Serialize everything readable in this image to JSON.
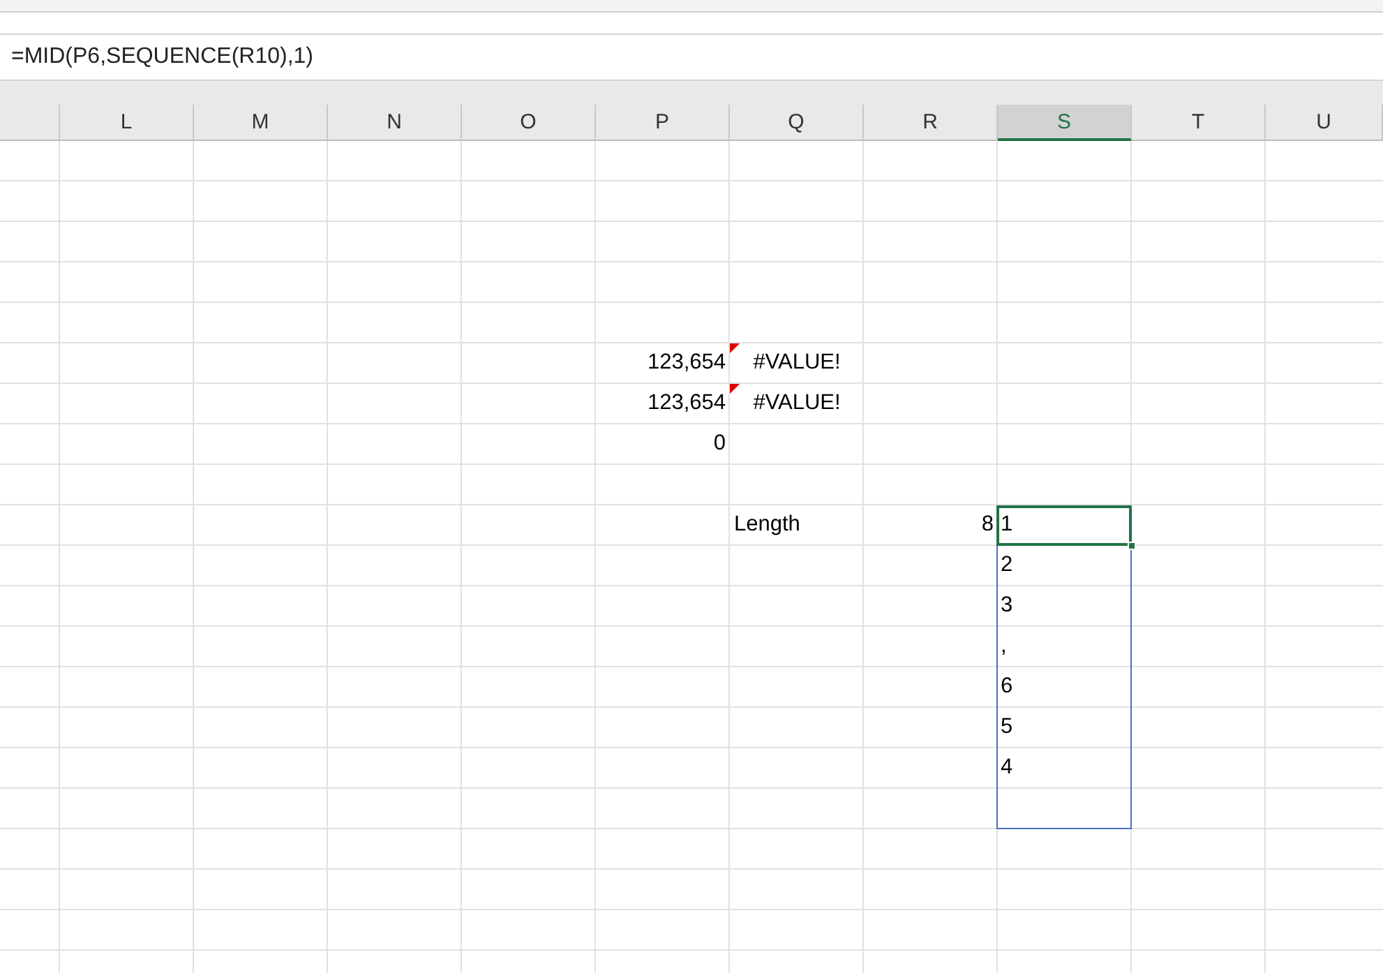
{
  "formula_bar": {
    "text": "=MID(P6,SEQUENCE(R10),1)"
  },
  "columns": [
    {
      "label": "L",
      "selected": false
    },
    {
      "label": "M",
      "selected": false
    },
    {
      "label": "N",
      "selected": false
    },
    {
      "label": "O",
      "selected": false
    },
    {
      "label": "P",
      "selected": false
    },
    {
      "label": "Q",
      "selected": false
    },
    {
      "label": "R",
      "selected": false
    },
    {
      "label": "S",
      "selected": true
    },
    {
      "label": "T",
      "selected": false
    },
    {
      "label": "U",
      "selected": false
    }
  ],
  "rows": [
    {},
    {},
    {},
    {},
    {},
    {
      "cells": [
        null,
        null,
        null,
        null,
        {
          "text": "123,654",
          "kind": "number",
          "selected": false
        },
        {
          "text": "#VALUE!",
          "kind": "error",
          "flagged": true,
          "selected": false
        }
      ]
    },
    {
      "cells": [
        null,
        null,
        null,
        null,
        {
          "text": "123,654",
          "kind": "number",
          "selected": false
        },
        {
          "text": "#VALUE!",
          "kind": "error",
          "flagged": true,
          "selected": false
        }
      ]
    },
    {
      "cells": [
        null,
        null,
        null,
        null,
        {
          "text": "0",
          "kind": "number",
          "selected": false
        }
      ]
    },
    {},
    {
      "cells": [
        null,
        null,
        null,
        null,
        null,
        {
          "text": "Length",
          "kind": "text",
          "selected": false
        },
        {
          "text": "8",
          "kind": "number",
          "selected": false
        },
        {
          "text": "1",
          "kind": "text",
          "spilled": true,
          "selected": true
        }
      ]
    },
    {
      "cells": [
        null,
        null,
        null,
        null,
        null,
        null,
        null,
        {
          "text": "2",
          "kind": "text",
          "spilled": true,
          "selected": false
        }
      ]
    },
    {
      "cells": [
        null,
        null,
        null,
        null,
        null,
        null,
        null,
        {
          "text": "3",
          "kind": "text",
          "spilled": true,
          "selected": false
        }
      ]
    },
    {
      "cells": [
        null,
        null,
        null,
        null,
        null,
        null,
        null,
        {
          "text": ",",
          "kind": "text",
          "spilled": true,
          "selected": false
        }
      ]
    },
    {
      "cells": [
        null,
        null,
        null,
        null,
        null,
        null,
        null,
        {
          "text": "6",
          "kind": "text",
          "spilled": true,
          "selected": false
        }
      ]
    },
    {
      "cells": [
        null,
        null,
        null,
        null,
        null,
        null,
        null,
        {
          "text": "5",
          "kind": "text",
          "spilled": true,
          "selected": false
        }
      ]
    },
    {
      "cells": [
        null,
        null,
        null,
        null,
        null,
        null,
        null,
        {
          "text": "4",
          "kind": "text",
          "spilled": true,
          "selected": false
        }
      ]
    },
    {
      "cells": [
        null,
        null,
        null,
        null,
        null,
        null,
        null,
        {
          "kind": "text",
          "spilled": true,
          "selected": false
        }
      ]
    },
    {},
    {},
    {},
    {}
  ]
}
